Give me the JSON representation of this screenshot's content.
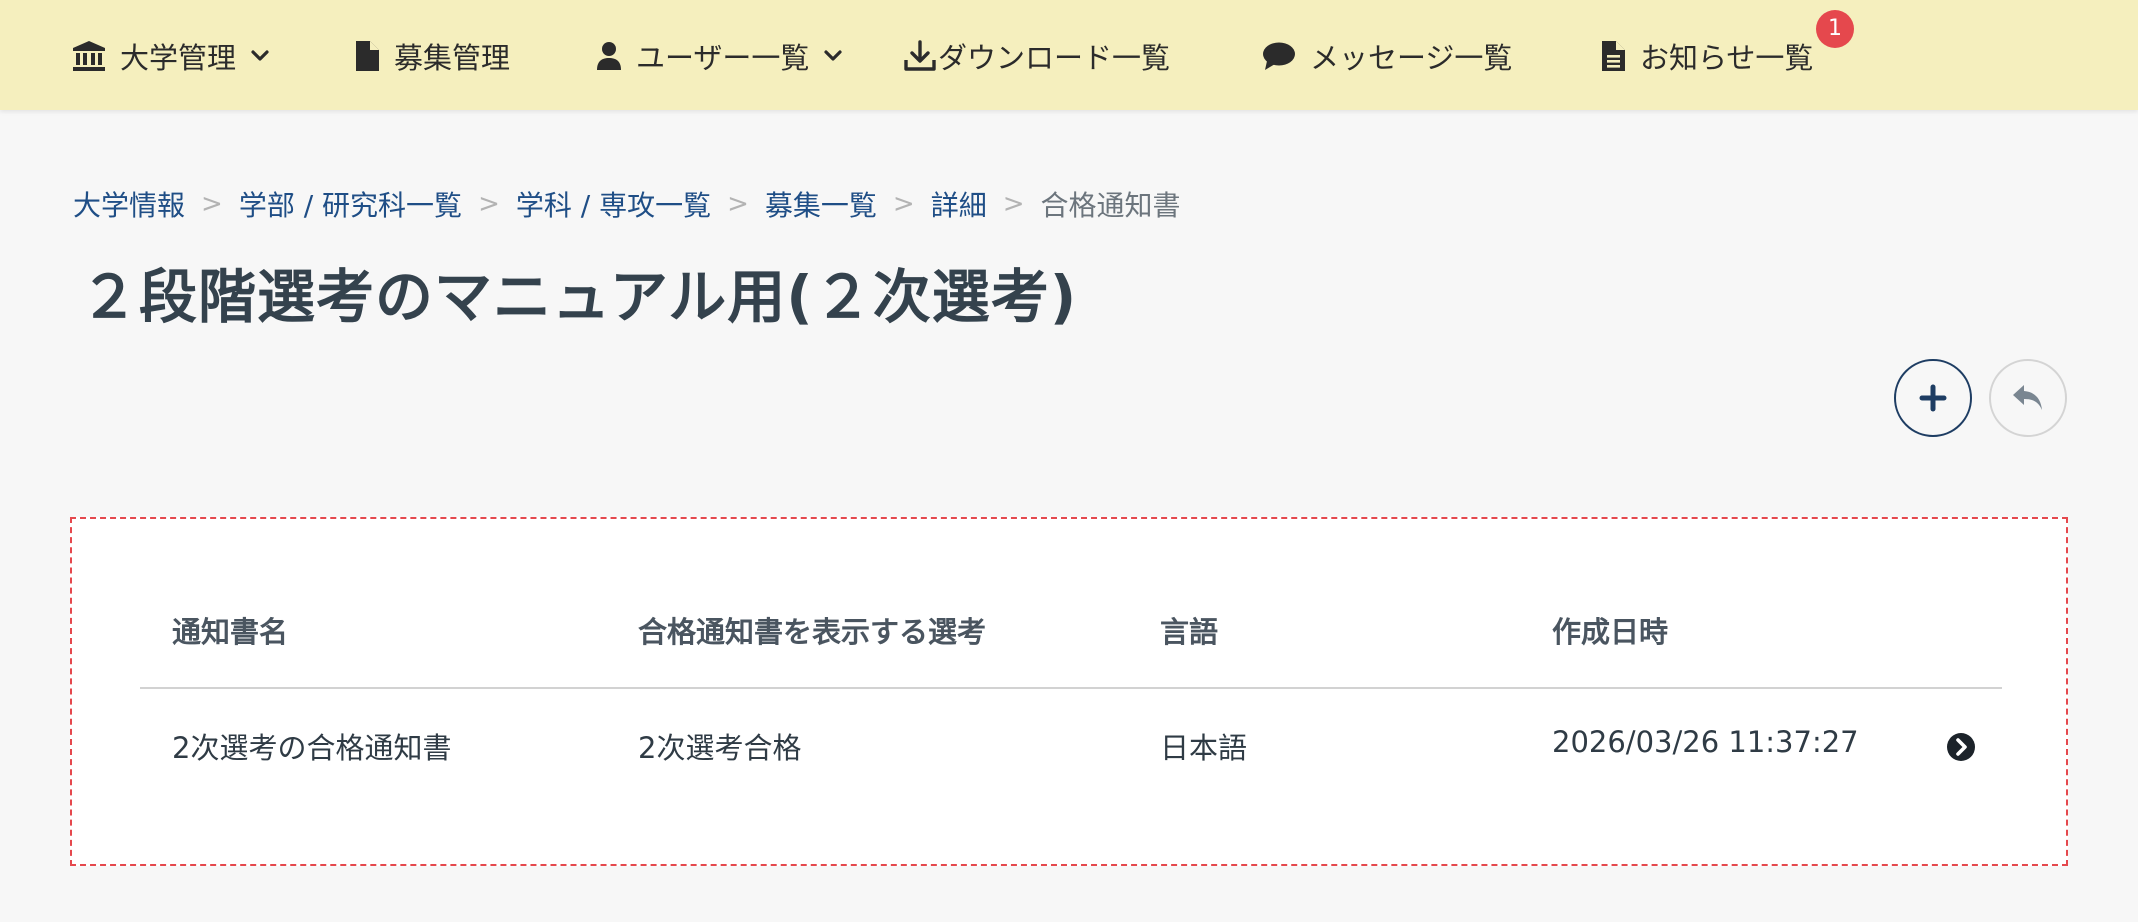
{
  "nav": {
    "items": [
      {
        "label": "大学管理",
        "icon": "university-icon",
        "has_dropdown": true
      },
      {
        "label": "募集管理",
        "icon": "file-icon",
        "has_dropdown": false
      },
      {
        "label": "ユーザー一覧",
        "icon": "user-icon",
        "has_dropdown": true
      },
      {
        "label": "ダウンロード一覧",
        "icon": "download-icon",
        "has_dropdown": false
      },
      {
        "label": "メッセージ一覧",
        "icon": "comment-icon",
        "has_dropdown": false
      },
      {
        "label": "お知らせ一覧",
        "icon": "document-icon",
        "has_dropdown": false
      }
    ],
    "notification_count": "1"
  },
  "breadcrumb": {
    "items": [
      "大学情報",
      "学部 / 研究科一覧",
      "学科 / 専攻一覧",
      "募集一覧",
      "詳細"
    ],
    "separator": ">",
    "current": "合格通知書"
  },
  "page": {
    "title": "２段階選考のマニュアル用(２次選考)"
  },
  "actions": {
    "add_icon": "plus-icon",
    "back_icon": "reply-icon"
  },
  "table": {
    "columns": [
      "通知書名",
      "合格通知書を表示する選考",
      "言語",
      "作成日時"
    ],
    "rows": [
      {
        "name": "2次選考の合格通知書",
        "selection": "2次選考合格",
        "language": "日本語",
        "created_at": "2026/03/26 11:37:27"
      }
    ]
  },
  "colors": {
    "nav_background": "#f5efbe",
    "link": "#1f4e86",
    "badge": "#e5484d",
    "dashed_border": "#e5484d",
    "add_button_border": "#1e3d63"
  }
}
